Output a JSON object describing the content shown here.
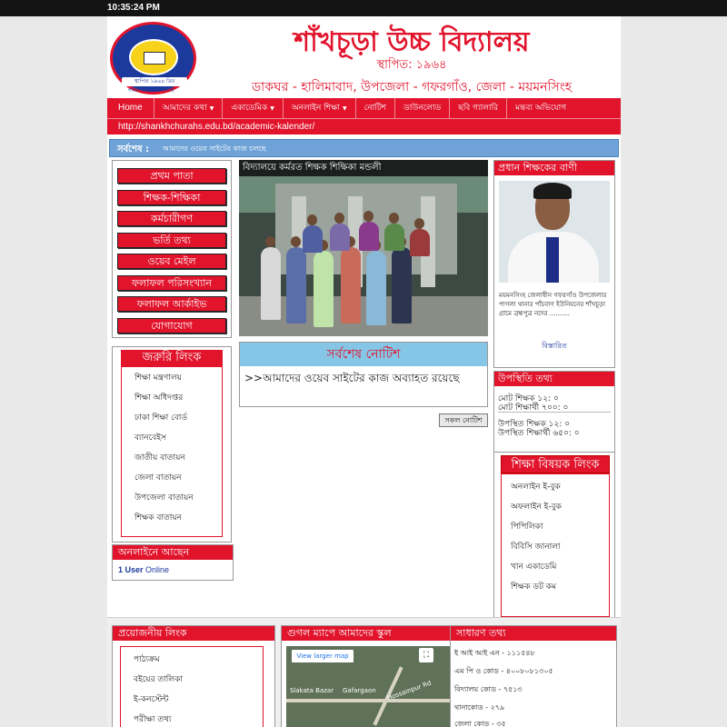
{
  "clock": "10:35:24 PM",
  "header": {
    "logo_ribbon": "স্থাপিত ১৯৬৪ খ্রিঃ",
    "logo_caption": "গফরগাঁও, ময়মনসিংহ",
    "school_name": "শাঁখচূড়া উচ্চ বিদ্যালয়",
    "established": "স্থাপিত: ১৯৬৪",
    "address": "ডাকঘর - হালিমাবাদ, উপজেলা - গফরগাঁও, জেলা - ময়মনসিংহ"
  },
  "nav": {
    "items": [
      {
        "label": "Home",
        "dropdown": false
      },
      {
        "label": "আমাদের কথা",
        "dropdown": true
      },
      {
        "label": "একাডেমিক",
        "dropdown": true
      },
      {
        "label": "অনলাইন শিক্ষা",
        "dropdown": true
      },
      {
        "label": "নোটিশ",
        "dropdown": false
      },
      {
        "label": "ডাউনলোড",
        "dropdown": false
      },
      {
        "label": "ছবি গ্যালারি",
        "dropdown": false
      },
      {
        "label": "মন্তব্য অভিযোগ",
        "dropdown": false
      }
    ],
    "url": "http://shankhchurahs.edu.bd/academic-kalender/"
  },
  "ticker": {
    "label": "সর্বশেষ :",
    "text": "আমাদের ওয়েব সাইটের কাজ চলছে"
  },
  "left_menu": [
    "প্রথম পাতা",
    "শিক্ষক-শিক্ষিকা",
    "কর্মচারীগণ",
    "ভর্তি তথ্য",
    "ওয়েব মেইল",
    "ফলাফল পরিসংখ্যান",
    "ফলাফল আর্কাইভ",
    "যোগাযোগ"
  ],
  "important_links": {
    "title": "জরুরি লিংক",
    "items": [
      "শিক্ষা মন্ত্রণালয়",
      "শিক্ষা অধিদপ্তর",
      "ঢাকা শিক্ষা বোর্ড",
      "ব্যানবেইস",
      "জাতীয় বাতায়ন",
      "জেলা বাতায়ন",
      "উপজেলা বাতায়ন",
      "শিক্ষক বাতায়ন"
    ]
  },
  "online": {
    "title": "অনলাইনে আছেন",
    "count": "1 User",
    "suffix": "Online"
  },
  "photo": {
    "caption": "বিদ্যালয়ে কর্মরত শিক্ষক শিক্ষিকা মন্ডলী"
  },
  "notice": {
    "title": "সর্বশেষ নোটিশ",
    "item": ">>আমাদের ওয়েব সাইটের কাজ অব্যাহত রয়েছে",
    "all_button": "সকল নোটিশ"
  },
  "headmaster": {
    "title": "প্রধান শিক্ষকের বাণী",
    "text": "ময়মনসিংহ জেলাধীন গফরগাঁও উপজেলার পাগলা থানার পাঁচবাগ ইউনিয়নের শাঁখচূড়া গ্রামে ব্রহ্মপুত্র নদের ..........",
    "more": "বিস্তারিত"
  },
  "attendance": {
    "title": "উপস্থিতি তথ্য",
    "total_teachers": "মোট শিক্ষক ১২: ০",
    "total_students": "মোট শিক্ষার্থী ৭০০: ০",
    "present_teachers": "উপস্থিত শিক্ষক ১২: ০",
    "present_students": "উপস্থিত শিক্ষার্থী ৬৫০: ০"
  },
  "edu_links": {
    "title": "শিক্ষা বিষয়ক লিংক",
    "items": [
      "অনলাইন ই-বুক",
      "অফলাইন ই-বুক",
      "পিপিলিকা",
      "বিবিসি জানালা",
      "খান একাডেমি",
      "শিক্ষক ডট কম"
    ]
  },
  "footer": {
    "links_title": "প্রয়োজনীয় লিংক",
    "links": [
      "পাঠ্যক্রম",
      "বইয়ের তালিকা",
      "ই-কনস্টেন্ট",
      "পরীক্ষা তথ্য"
    ],
    "map_title": "গুগল ম্যাপে আমাদের স্কুল",
    "map_button": "View larger map",
    "map_label_1": "Slakata Bazar",
    "map_label_2": "Gafargaon",
    "map_label_3": "Hossainpur Rd",
    "info_title": "সাধারণ তথ্য",
    "info": [
      "ই আই আই এন - ১১১৫৪৮",
      "এম পি ও কোড - ৪০০৮০৮১৩০৫",
      "বিদ্যালয় কোড - ৭৫১৩",
      "থানাকোড - ২৭৯",
      "জেলা কোড - ৩৫"
    ]
  },
  "colors": {
    "brand_red": "#e1142c",
    "ticker_blue": "#6fa3d8",
    "notice_blue": "#85c5e6"
  }
}
